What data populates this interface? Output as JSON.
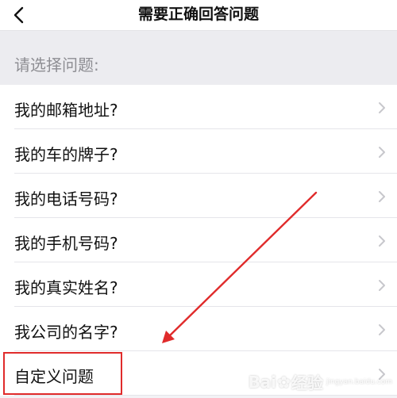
{
  "nav": {
    "title": "需要正确回答问题"
  },
  "section": {
    "header": "请选择问题:"
  },
  "questions": [
    {
      "label": "我的邮箱地址?"
    },
    {
      "label": "我的车的牌子?"
    },
    {
      "label": "我的电话号码?"
    },
    {
      "label": "我的手机号码?"
    },
    {
      "label": "我的真实姓名?"
    },
    {
      "label": "我公司的名字?"
    },
    {
      "label": "自定义问题"
    }
  ],
  "annotation": {
    "highlight_color": "#e02b2b",
    "arrow_color": "#e02b2b"
  },
  "watermark": {
    "brand": "Bai",
    "brand2": "经验",
    "site": "jingyan.baidu.com"
  },
  "colors": {
    "background": "#f2f2f5",
    "text": "#111111",
    "secondary_text": "#8e8e93",
    "chevron": "#c7c7cc"
  }
}
